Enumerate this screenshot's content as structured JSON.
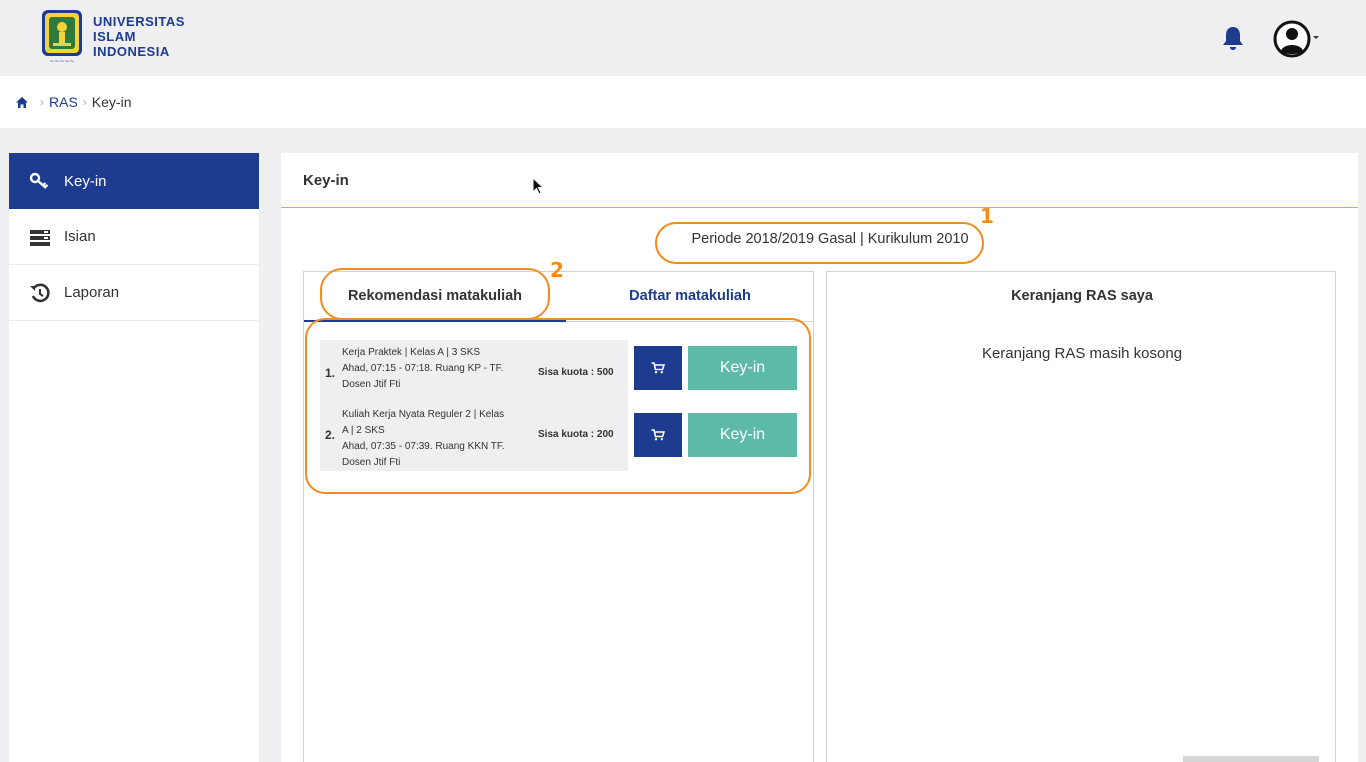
{
  "header": {
    "brand_lines": [
      "UNIVERSITAS",
      "ISLAM",
      "INDONESIA"
    ],
    "colors": {
      "primary": "#1d3c8f",
      "accent": "#5dbaa9",
      "annotation": "#f28c1e"
    }
  },
  "breadcrumb": {
    "items": [
      "RAS",
      "Key-in"
    ]
  },
  "sidebar": {
    "items": [
      {
        "label": "Key-in",
        "icon": "key-icon",
        "active": true
      },
      {
        "label": "Isian",
        "icon": "list-icon",
        "active": false
      },
      {
        "label": "Laporan",
        "icon": "history-icon",
        "active": false
      }
    ]
  },
  "main": {
    "panel_title": "Key-in",
    "periode": "Periode 2018/2019 Gasal | Kurikulum 2010",
    "tabs": [
      {
        "label": "Rekomendasi matakuliah",
        "active": true
      },
      {
        "label": "Daftar matakuliah",
        "active": false
      }
    ],
    "courses": [
      {
        "num": "1.",
        "lines": [
          "Kerja Praktek | Kelas A | 3 SKS",
          "Ahad, 07:15 - 07:18. Ruang KP - TF.",
          "Dosen Jtif Fti"
        ],
        "quota": "Sisa kuota : 500",
        "button": "Key-in"
      },
      {
        "num": "2.",
        "lines": [
          "Kuliah Kerja Nyata Reguler 2 | Kelas",
          "A | 2 SKS",
          "Ahad, 07:35 - 07:39. Ruang KKN TF.",
          "Dosen Jtif Fti"
        ],
        "quota": "Sisa kuota : 200",
        "button": "Key-in"
      }
    ],
    "cart": {
      "title": "Keranjang RAS saya",
      "empty_text": "Keranjang RAS masih kosong"
    }
  },
  "annotations": [
    "1",
    "2"
  ]
}
